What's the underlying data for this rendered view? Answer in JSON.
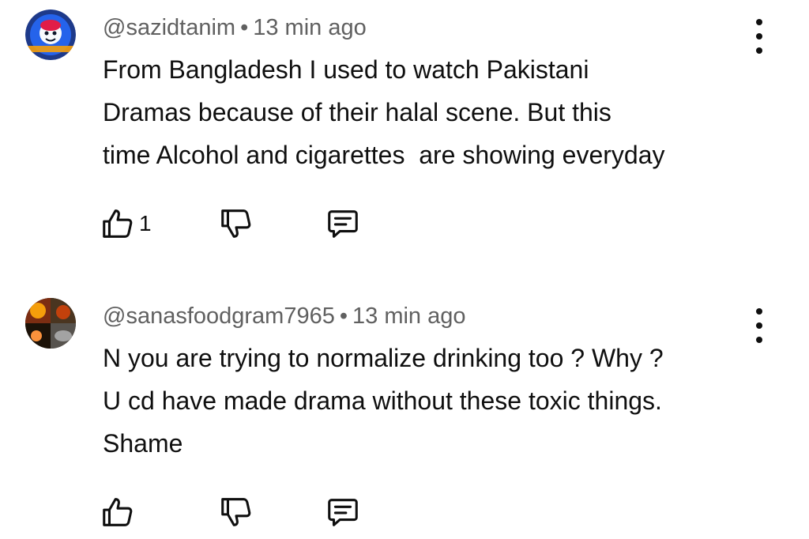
{
  "comments": [
    {
      "handle": "@sazidtanim",
      "time": "13 min ago",
      "lines": [
        "From Bangladesh I used to watch Pakistani",
        "Dramas because of their halal scene. But this",
        "time Alcohol and cigarettes  are showing everyday"
      ],
      "like_count": "1",
      "avatar_icon": "cartoon-character-avatar",
      "avatar_colors": [
        "#1e3a8a",
        "#e11d48",
        "#f8fafc"
      ]
    },
    {
      "handle": "@sanasfoodgram7965",
      "time": "13 min ago",
      "lines": [
        "N you are trying to normalize drinking too ? Why ?",
        "U cd have made drama without these toxic things.",
        "Shame"
      ],
      "like_count": "",
      "avatar_icon": "food-collage-avatar",
      "avatar_colors": [
        "#3b2a1a",
        "#c2410c",
        "#f59e0b"
      ]
    }
  ],
  "separator": "•",
  "icons": {
    "like": "thumbs-up-icon",
    "dislike": "thumbs-down-icon",
    "reply": "reply-comment-icon",
    "more": "more-vertical-icon"
  }
}
